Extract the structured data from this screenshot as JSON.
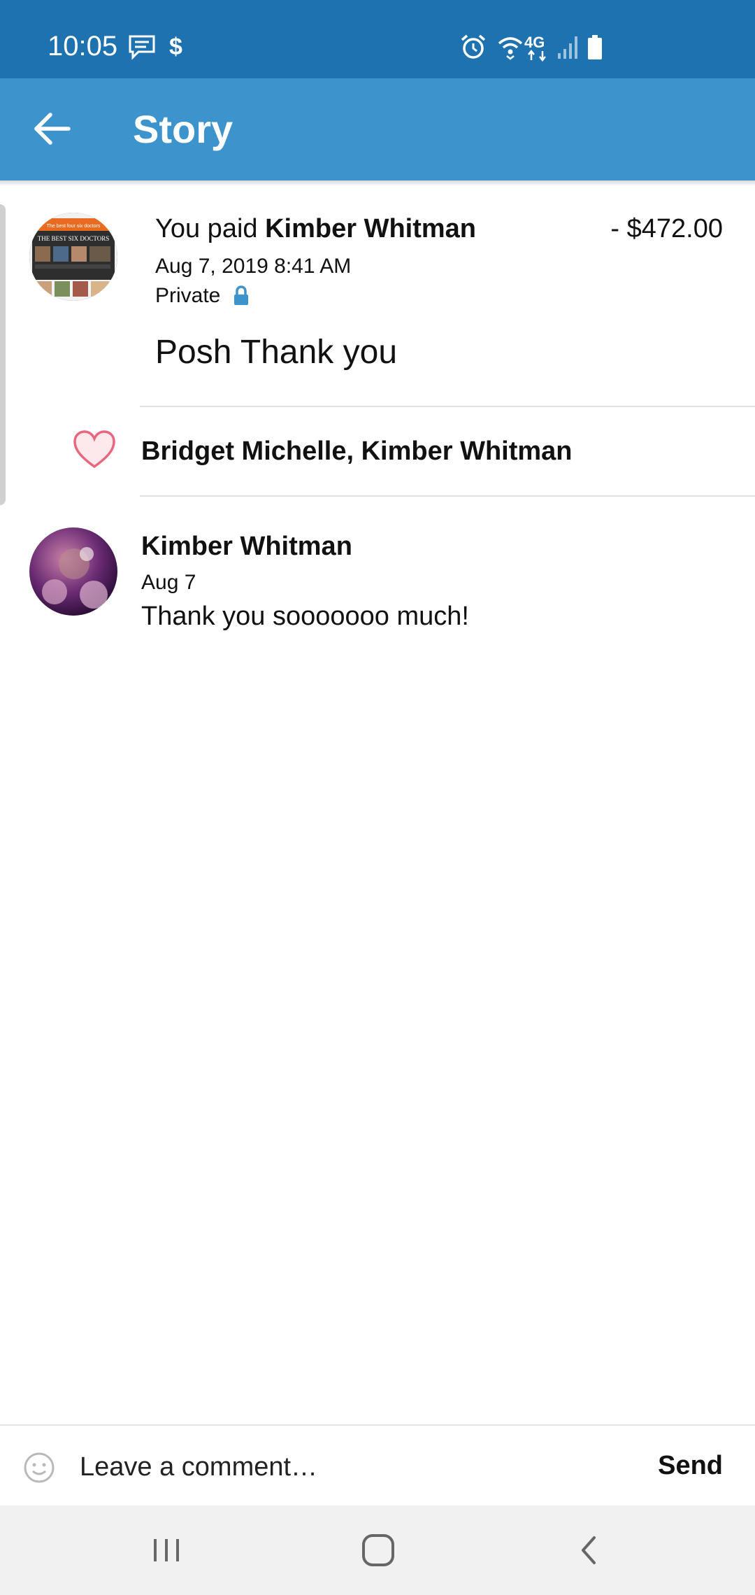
{
  "status_bar": {
    "time": "10:05",
    "left_icons": [
      "message-icon",
      "dollar-icon"
    ],
    "right_icons": [
      "alarm-icon",
      "wifi-icon",
      "4g-lte-icon",
      "signal-icon",
      "battery-icon"
    ],
    "network_label": "4G"
  },
  "app_bar": {
    "title": "Story",
    "back_icon": "arrow-left-icon",
    "color": "#3d94cc"
  },
  "story": {
    "prefix": "You paid ",
    "recipient": "Kimber Whitman",
    "amount": "- $472.00",
    "date": "Aug 7, 2019 8:41 AM",
    "privacy": "Private",
    "privacy_icon": "lock-icon",
    "note": "Posh Thank you",
    "avatar_title": "THE BEST SIX DOCTORS",
    "avatar_tagline": "The best four six doctors"
  },
  "likes": {
    "icon": "heart-icon",
    "names": "Bridget Michelle, Kimber Whitman"
  },
  "comments": [
    {
      "name": "Kimber Whitman",
      "date": "Aug 7",
      "text": "Thank you sooooooo much!"
    }
  ],
  "comment_bar": {
    "placeholder": "Leave a comment…",
    "send_label": "Send",
    "emoji_icon": "emoji-icon"
  },
  "nav_bar": {
    "buttons": [
      "recent-apps-icon",
      "home-icon",
      "back-icon"
    ]
  }
}
